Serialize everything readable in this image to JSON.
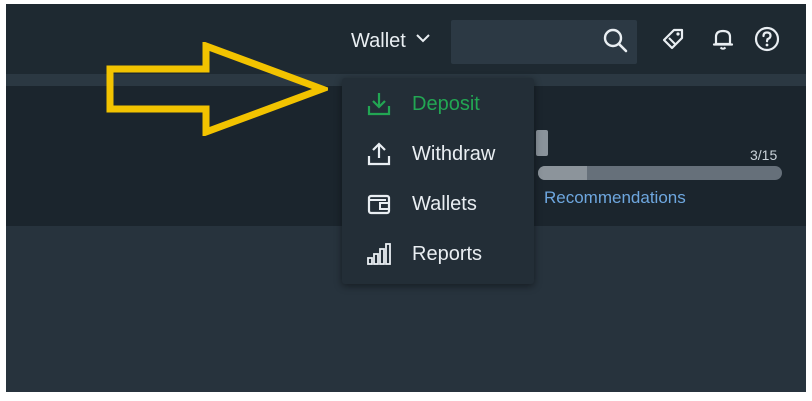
{
  "header": {
    "wallet_label": "Wallet",
    "search": {
      "value": "",
      "placeholder": ""
    },
    "icons": [
      "search-icon",
      "promo-icon",
      "bell-icon",
      "help-icon"
    ]
  },
  "wallet_menu": {
    "items": [
      {
        "label": "Deposit",
        "icon": "download-icon",
        "active": true
      },
      {
        "label": "Withdraw",
        "icon": "upload-icon",
        "active": false
      },
      {
        "label": "Wallets",
        "icon": "wallet-icon",
        "active": false
      },
      {
        "label": "Reports",
        "icon": "bar-chart-icon",
        "active": false
      }
    ]
  },
  "content": {
    "progress": {
      "text": "3/15",
      "current": 3,
      "total": 15
    },
    "recommendations_link": "Recommendations"
  },
  "colors": {
    "background": "#1f2a33",
    "menu_background": "#232e37",
    "active_item": "#22a653",
    "link": "#6ea7df",
    "annotation_arrow": "#f2c300"
  }
}
